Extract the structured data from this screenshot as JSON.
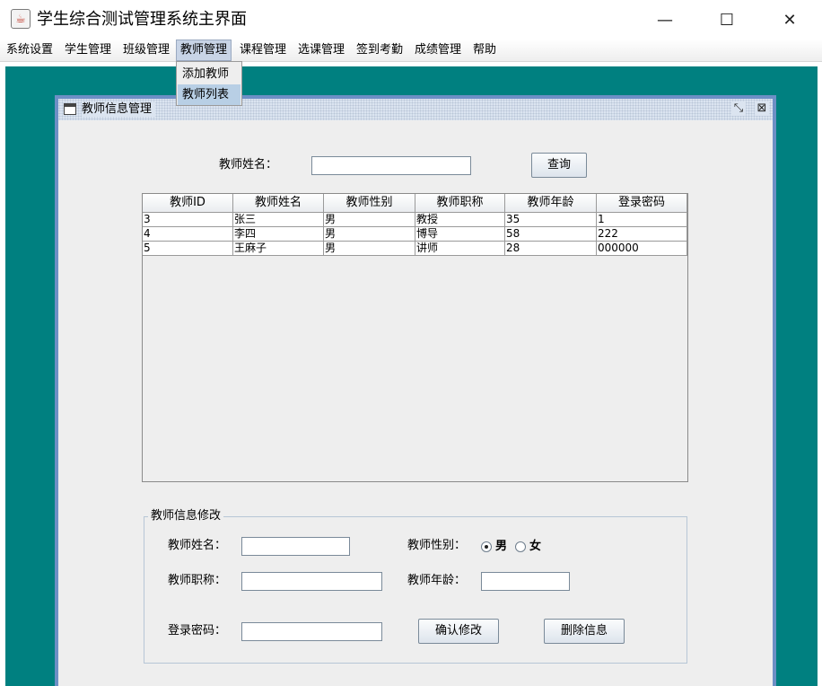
{
  "window": {
    "title": "学生综合测试管理系统主界面",
    "minimize_glyph": "—",
    "maximize_glyph": "☐",
    "close_glyph": "✕",
    "app_icon": "java-cup-icon"
  },
  "menubar": {
    "items": [
      "系统设置",
      "学生管理",
      "班级管理",
      "教师管理",
      "课程管理",
      "选课管理",
      "签到考勤",
      "成绩管理",
      "帮助"
    ],
    "active_index": 3
  },
  "dropdown": {
    "items": [
      "添加教师",
      "教师列表"
    ],
    "highlighted_index": 1
  },
  "internal_frame": {
    "title": "教师信息管理",
    "restore_glyph": "⤡",
    "close_glyph": "⊠"
  },
  "search": {
    "label": "教师姓名：",
    "value": "",
    "button": "查询"
  },
  "table": {
    "columns": [
      "教师ID",
      "教师姓名",
      "教师性别",
      "教师职称",
      "教师年龄",
      "登录密码"
    ],
    "rows": [
      [
        "3",
        "张三",
        "男",
        "教授",
        "35",
        "1"
      ],
      [
        "4",
        "李四",
        "男",
        "博导",
        "58",
        "222"
      ],
      [
        "5",
        "王麻子",
        "男",
        "讲师",
        "28",
        "000000"
      ]
    ]
  },
  "edit_form": {
    "group_title": "教师信息修改",
    "name_label": "教师姓名：",
    "name_value": "",
    "gender_label": "教师性别：",
    "gender_male": "男",
    "gender_female": "女",
    "gender_selected": "男",
    "title_label": "教师职称：",
    "title_value": "",
    "age_label": "教师年龄：",
    "age_value": "",
    "password_label": "登录密码：",
    "password_value": "",
    "confirm_button": "确认修改",
    "delete_button": "删除信息"
  },
  "colors": {
    "desktop": "#008080",
    "frame_border": "#6d8fc5",
    "menu_highlight": "#c8d4e6"
  }
}
